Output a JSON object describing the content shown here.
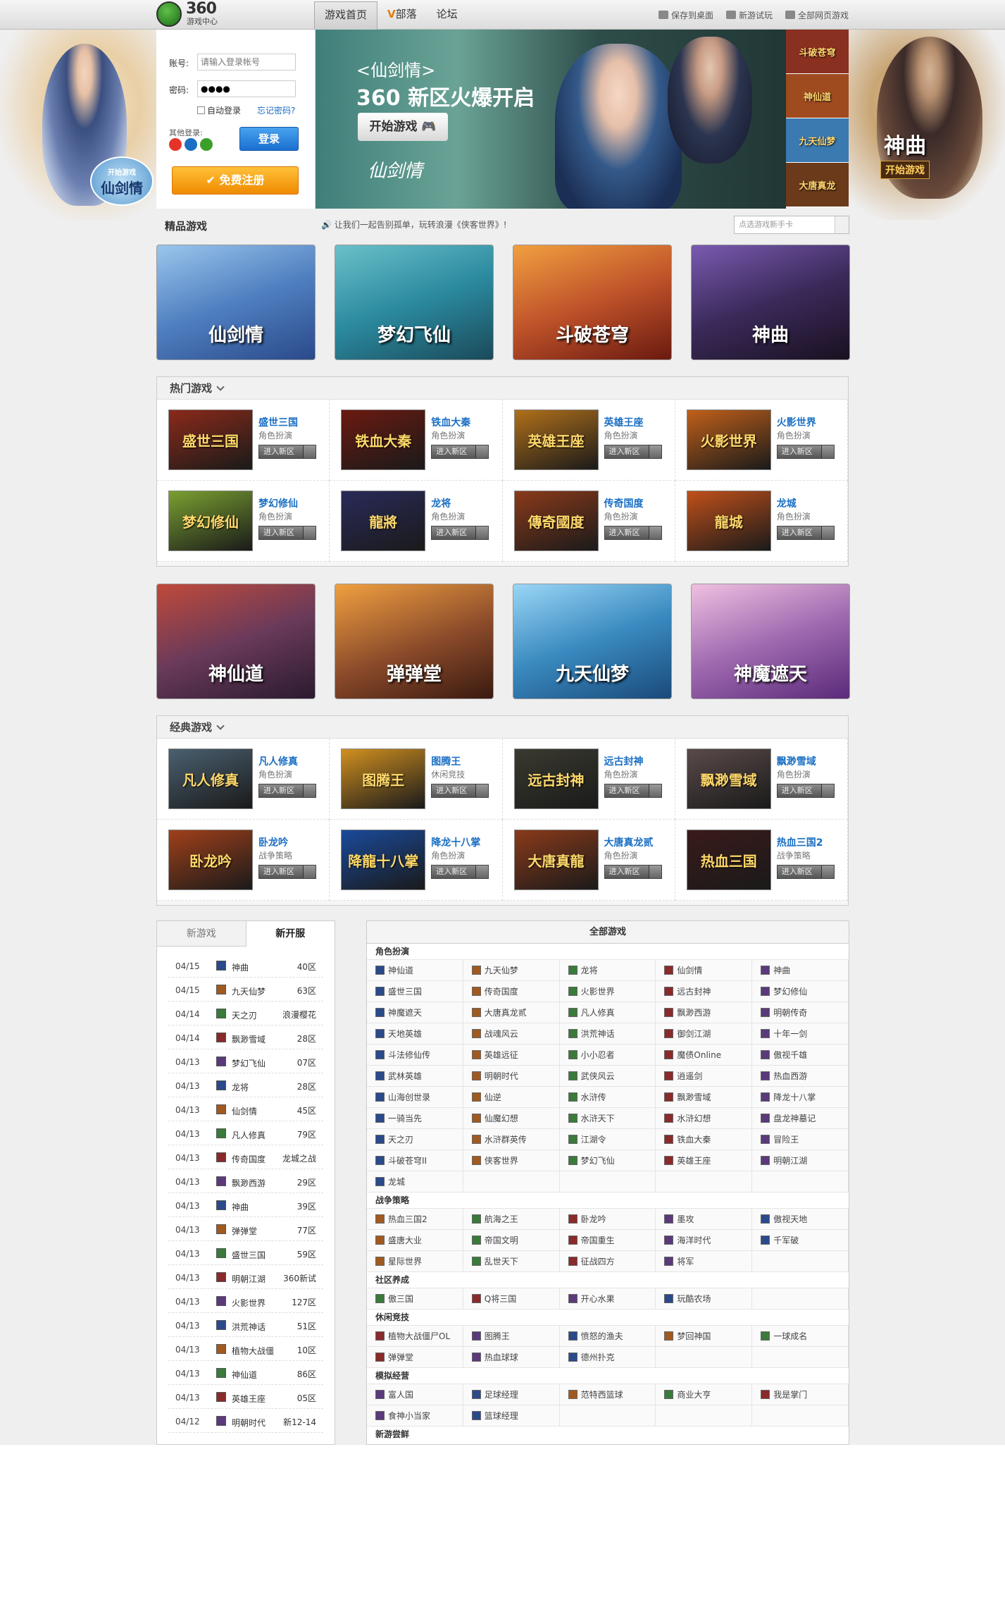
{
  "header": {
    "logo_num": "360",
    "logo_text": "游戏中心",
    "nav": [
      "游戏首页",
      "部落",
      "论坛"
    ],
    "nav_v": "V",
    "links": [
      "保存到桌面",
      "新游试玩",
      "全部网页游戏"
    ]
  },
  "side": {
    "left_logo_small": "开始游戏",
    "left_logo": "仙剑情",
    "right_logo": "神曲",
    "right_btn": "开始游戏"
  },
  "login": {
    "account_label": "账号:",
    "account_placeholder": "请输入登录帐号",
    "password_label": "密码:",
    "password_value": "●●●●",
    "auto": "自动登录",
    "forgot": "忘记密码?",
    "other": "其他登录:",
    "login_btn": "登录",
    "register_btn": "免费注册"
  },
  "banner": {
    "game": "<仙剑情>",
    "headline": "360 新区火爆开启",
    "start": "开始游戏",
    "logo": "仙剑情",
    "thumbs": [
      "斗破苍穹",
      "神仙道",
      "九天仙梦",
      "大唐真龙"
    ]
  },
  "featured": {
    "title": "精品游戏",
    "notice": "让我们一起告别孤单，玩转浪漫《侠客世界》!",
    "card_select": "点选游戏新手卡",
    "cards": [
      "仙剑情",
      "梦幻飞仙",
      "斗破苍穹",
      "神曲"
    ],
    "colors": [
      "#4f7fc0",
      "#2b8a9f",
      "#c0532a",
      "#3a2a5a"
    ]
  },
  "hot": {
    "title": "热门游戏",
    "enter": "进入新区",
    "games": [
      {
        "name": "盛世三国",
        "type": "角色扮演",
        "art": "盛世三国",
        "color": "#8a2a1a"
      },
      {
        "name": "铁血大秦",
        "type": "角色扮演",
        "art": "铁血大秦",
        "color": "#6a1a10"
      },
      {
        "name": "英雄王座",
        "type": "角色扮演",
        "art": "英雄王座",
        "color": "#b0701a"
      },
      {
        "name": "火影世界",
        "type": "角色扮演",
        "art": "火影世界",
        "color": "#c0601a"
      },
      {
        "name": "梦幻修仙",
        "type": "角色扮演",
        "art": "梦幻修仙",
        "color": "#7aa030"
      },
      {
        "name": "龙将",
        "type": "角色扮演",
        "art": "龍將",
        "color": "#2a2a5a"
      },
      {
        "name": "传奇国度",
        "type": "角色扮演",
        "art": "傳奇國度",
        "color": "#8a3a1a"
      },
      {
        "name": "龙城",
        "type": "角色扮演",
        "art": "龍城",
        "color": "#c0501a"
      }
    ]
  },
  "mid": {
    "cards": [
      "神仙道",
      "弹弹堂",
      "九天仙梦",
      "神魔遮天"
    ],
    "colors": [
      "#6a3a5a",
      "#8a4a2a",
      "#3a8ac0",
      "#a06ab0"
    ]
  },
  "classic": {
    "title": "经典游戏",
    "enter": "进入新区",
    "games": [
      {
        "name": "凡人修真",
        "type": "角色扮演",
        "art": "凡人修真",
        "color": "#4a6070"
      },
      {
        "name": "图腾王",
        "type": "休闲竞技",
        "art": "图腾王",
        "color": "#d09020"
      },
      {
        "name": "远古封神",
        "type": "角色扮演",
        "art": "远古封神",
        "color": "#3a3a30"
      },
      {
        "name": "飘渺雪域",
        "type": "角色扮演",
        "art": "飘渺雪域",
        "color": "#5a4a4a"
      },
      {
        "name": "卧龙吟",
        "type": "战争策略",
        "art": "卧龙吟",
        "color": "#a0401a"
      },
      {
        "name": "降龙十八掌",
        "type": "角色扮演",
        "art": "降龍十八掌",
        "color": "#1a4a9a"
      },
      {
        "name": "大唐真龙贰",
        "type": "角色扮演",
        "art": "大唐真龍",
        "color": "#8a3a1a"
      },
      {
        "name": "热血三国2",
        "type": "战争策略",
        "art": "热血三国",
        "color": "#3a1a1a"
      }
    ]
  },
  "servers": {
    "tabs": [
      "新游戏",
      "新开服"
    ],
    "rows": [
      {
        "date": "04/15",
        "name": "神曲",
        "zone": "40区"
      },
      {
        "date": "04/15",
        "name": "九天仙梦",
        "zone": "63区"
      },
      {
        "date": "04/14",
        "name": "天之刃",
        "zone": "浪漫樱花"
      },
      {
        "date": "04/14",
        "name": "飘渺雪域",
        "zone": "28区"
      },
      {
        "date": "04/13",
        "name": "梦幻飞仙",
        "zone": "07区"
      },
      {
        "date": "04/13",
        "name": "龙将",
        "zone": "28区"
      },
      {
        "date": "04/13",
        "name": "仙剑情",
        "zone": "45区"
      },
      {
        "date": "04/13",
        "name": "凡人修真",
        "zone": "79区"
      },
      {
        "date": "04/13",
        "name": "传奇国度",
        "zone": "龙城之战"
      },
      {
        "date": "04/13",
        "name": "飘渺西游",
        "zone": "29区"
      },
      {
        "date": "04/13",
        "name": "神曲",
        "zone": "39区"
      },
      {
        "date": "04/13",
        "name": "弹弹堂",
        "zone": "77区"
      },
      {
        "date": "04/13",
        "name": "盛世三国",
        "zone": "59区"
      },
      {
        "date": "04/13",
        "name": "明朝江湖",
        "zone": "360新试"
      },
      {
        "date": "04/13",
        "name": "火影世界",
        "zone": "127区"
      },
      {
        "date": "04/13",
        "name": "洪荒神话",
        "zone": "51区"
      },
      {
        "date": "04/13",
        "name": "植物大战僵",
        "zone": "10区"
      },
      {
        "date": "04/13",
        "name": "神仙道",
        "zone": "86区"
      },
      {
        "date": "04/13",
        "name": "英雄王座",
        "zone": "05区"
      },
      {
        "date": "04/12",
        "name": "明朝时代",
        "zone": "新12-14"
      }
    ]
  },
  "all": {
    "title": "全部游戏",
    "categories": [
      {
        "name": "角色扮演",
        "games": [
          "神仙道",
          "九天仙梦",
          "龙将",
          "仙剑情",
          "神曲",
          "盛世三国",
          "传奇国度",
          "火影世界",
          "远古封神",
          "梦幻修仙",
          "神魔遮天",
          "大唐真龙贰",
          "凡人修真",
          "飘渺西游",
          "明朝传奇",
          "天地英雄",
          "战魂风云",
          "洪荒神话",
          "御剑江湖",
          "十年一剑",
          "斗法修仙传",
          "英雄远征",
          "小小忍者",
          "魔债Online",
          "傲视千雄",
          "武林英雄",
          "明朝时代",
          "武侠风云",
          "逍遥剑",
          "热血西游",
          "山海创世录",
          "仙逆",
          "水浒传",
          "飘渺雪域",
          "降龙十八掌",
          "一骑当先",
          "仙魔幻想",
          "水浒天下",
          "水浒幻想",
          "盘龙神墓记",
          "天之刃",
          "水浒群英传",
          "江湖令",
          "铁血大秦",
          "冒险王",
          "斗破苍穹II",
          "侠客世界",
          "梦幻飞仙",
          "英雄王座",
          "明朝江湖",
          "龙城"
        ]
      },
      {
        "name": "战争策略",
        "games": [
          "热血三国2",
          "航海之王",
          "卧龙吟",
          "墨攻",
          "傲视天地",
          "盛唐大业",
          "帝国文明",
          "帝国重生",
          "海洋时代",
          "千军破",
          "星际世界",
          "乱世天下",
          "征战四方",
          "将军"
        ]
      },
      {
        "name": "社区养成",
        "games": [
          "傲三国",
          "Q将三国",
          "开心水果",
          "玩酷农场"
        ]
      },
      {
        "name": "休闲竞技",
        "games": [
          "植物大战僵尸OL",
          "图腾王",
          "愤怒的渔夫",
          "梦回神国",
          "一球成名",
          "弹弹堂",
          "热血球球",
          "德州扑克"
        ]
      },
      {
        "name": "模拟经营",
        "games": [
          "富人国",
          "足球经理",
          "范特西篮球",
          "商业大亨",
          "我是掌门",
          "食神小当家",
          "篮球经理"
        ]
      },
      {
        "name": "新游尝鲜",
        "games": []
      }
    ]
  }
}
